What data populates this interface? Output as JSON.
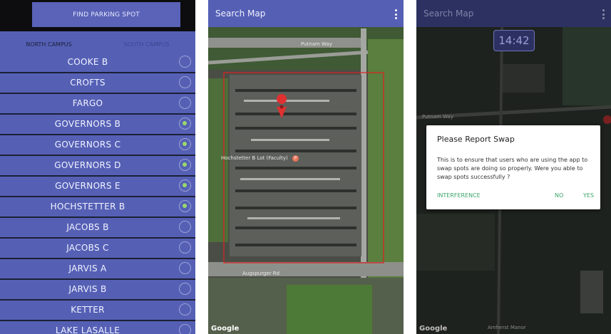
{
  "panel1": {
    "find_button": "FIND PARKING SPOT",
    "tabs": [
      {
        "label": "NORTH CAMPUS",
        "selected": true
      },
      {
        "label": "SOUTH CAMPUS",
        "selected": false
      }
    ],
    "lots": [
      {
        "name": "COOKE B",
        "selected": false
      },
      {
        "name": "CROFTS",
        "selected": false
      },
      {
        "name": "FARGO",
        "selected": false
      },
      {
        "name": "GOVERNORS B",
        "selected": true
      },
      {
        "name": "GOVERNORS C",
        "selected": true
      },
      {
        "name": "GOVERNORS D",
        "selected": true
      },
      {
        "name": "GOVERNORS E",
        "selected": true
      },
      {
        "name": "HOCHSTETTER B",
        "selected": true
      },
      {
        "name": "JACOBS B",
        "selected": false
      },
      {
        "name": "JACOBS C",
        "selected": false
      },
      {
        "name": "JARVIS A",
        "selected": false
      },
      {
        "name": "JARVIS B",
        "selected": false
      },
      {
        "name": "KETTER",
        "selected": false
      },
      {
        "name": "LAKE LASALLE",
        "selected": false
      }
    ]
  },
  "panel2": {
    "title": "Search Map",
    "labels": {
      "road_top": "Putnam Way",
      "lot_name": "Hochstetter B Lot (Faculty)",
      "road_bottom": "Augspurger Rd"
    },
    "attribution": "Google"
  },
  "panel3": {
    "title": "Search Map",
    "clock": "14:42",
    "dialog": {
      "title": "Please Report Swap",
      "body": "This is to ensure that users who are using the app to swap spots are doing so properly. Were you able to swap spots successfully ?",
      "buttons": {
        "interference": "INTERFERENCE",
        "no": "NO",
        "yes": "YES"
      }
    },
    "labels": {
      "road": "Putnam Way",
      "street": "Amherst Manor"
    },
    "attribution": "Google"
  },
  "colors": {
    "primary": "#5560b5",
    "accent_pink": "#f06a8a",
    "radio_on": "#9bd86a",
    "dialog_button": "#3aa56a",
    "map_outline": "#e02020"
  }
}
